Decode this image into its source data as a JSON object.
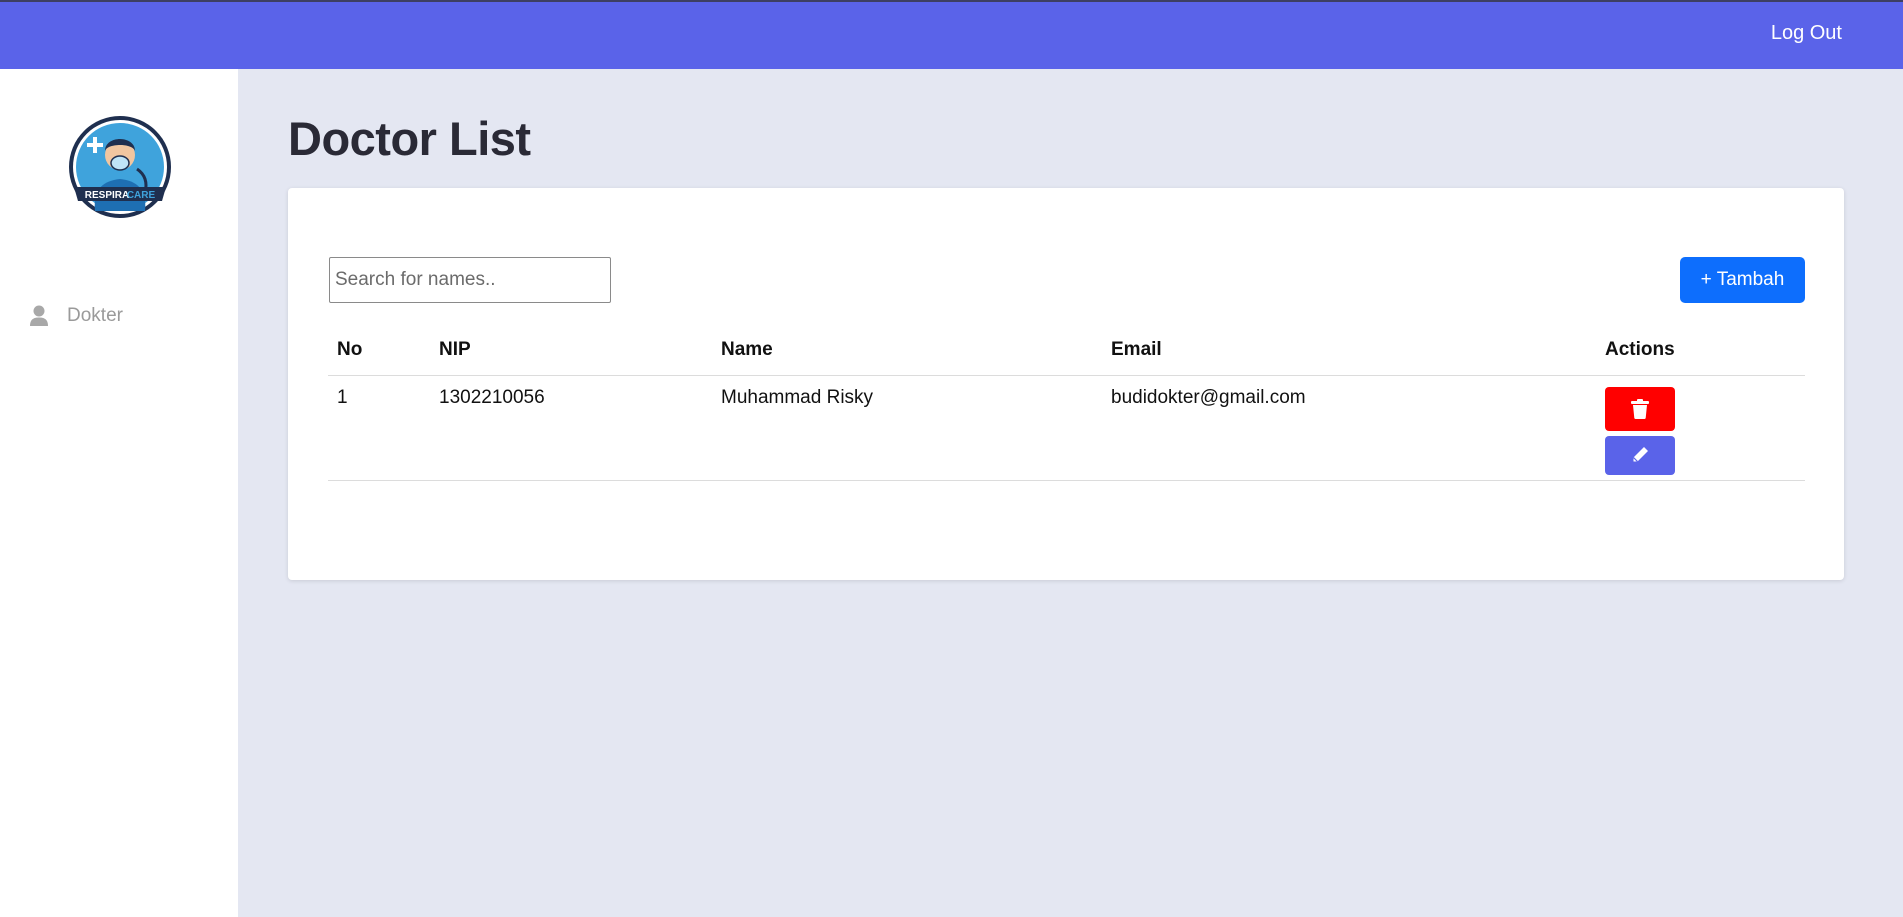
{
  "colors": {
    "topbar": "#5a63e9",
    "background": "#e4e7f2",
    "primary_button": "#0d6efd",
    "delete_button": "#ff0000",
    "edit_button": "#5a63e9"
  },
  "topbar": {
    "logout_label": "Log Out"
  },
  "sidebar": {
    "logo": {
      "icon": "respira-care-logo",
      "text_primary": "RESPIRA",
      "text_secondary": "CARE"
    },
    "items": [
      {
        "label": "Dokter",
        "icon": "user-icon"
      }
    ]
  },
  "main": {
    "title": "Doctor List",
    "search": {
      "placeholder": "Search for names..",
      "value": ""
    },
    "add_button_label": "+ Tambah",
    "table": {
      "columns": [
        "No",
        "NIP",
        "Name",
        "Email",
        "Actions"
      ],
      "rows": [
        {
          "no": "1",
          "nip": "1302210056",
          "name": "Muhammad Risky",
          "email": "budidokter@gmail.com",
          "actions": [
            "trash-icon",
            "pencil-icon"
          ]
        }
      ]
    }
  }
}
